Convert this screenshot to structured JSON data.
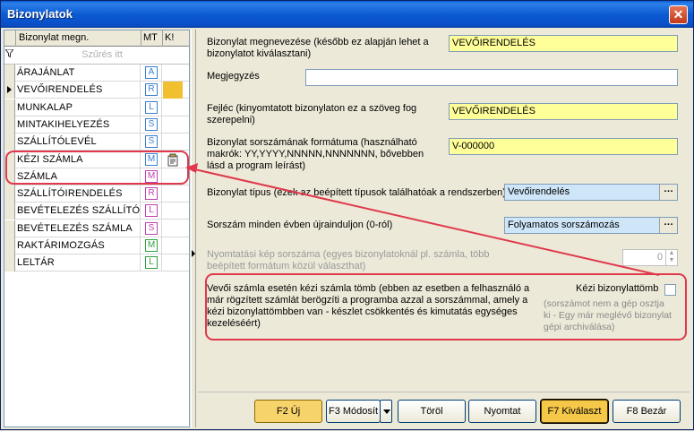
{
  "window": {
    "title": "Bizonylatok",
    "close_icon": "close-icon"
  },
  "grid": {
    "columns": [
      "Bizonylat megn.",
      "MT",
      "K!"
    ],
    "filter_placeholder": "Szűrés itt",
    "rows": [
      {
        "name": "ÁRAJÁNLAT",
        "mt": "A",
        "mt_color": "#3a7fd0",
        "selected": false,
        "k_icon": false
      },
      {
        "name": "VEVŐIRENDELÉS",
        "mt": "R",
        "mt_color": "#3a7fd0",
        "selected": true,
        "k_icon": false
      },
      {
        "name": "MUNKALAP",
        "mt": "L",
        "mt_color": "#3a7fd0",
        "selected": false,
        "k_icon": false
      },
      {
        "name": "MINTAKIHELYEZÉS",
        "mt": "S",
        "mt_color": "#3a7fd0",
        "selected": false,
        "k_icon": false
      },
      {
        "name": "SZÁLLÍTÓLEVÉL",
        "mt": "S",
        "mt_color": "#3a7fd0",
        "selected": false,
        "k_icon": false
      },
      {
        "name": "KÉZI SZÁMLA",
        "mt": "M",
        "mt_color": "#3a7fd0",
        "selected": false,
        "k_icon": true
      },
      {
        "name": "SZÁMLA",
        "mt": "M",
        "mt_color": "#c040b0",
        "selected": false,
        "k_icon": false
      },
      {
        "name": "SZÁLLÍTÓIRENDELÉS",
        "mt": "R",
        "mt_color": "#c040b0",
        "selected": false,
        "k_icon": false
      },
      {
        "name": "BEVÉTELEZÉS SZÁLLÍTÓ",
        "mt": "L",
        "mt_color": "#c040b0",
        "selected": false,
        "k_icon": false
      },
      {
        "name": "BEVÉTELEZÉS SZÁMLA",
        "mt": "S",
        "mt_color": "#c040b0",
        "selected": false,
        "k_icon": false
      },
      {
        "name": "RAKTÁRIMOZGÁS",
        "mt": "M",
        "mt_color": "#30a040",
        "selected": false,
        "k_icon": false
      },
      {
        "name": "LELTÁR",
        "mt": "L",
        "mt_color": "#30a040",
        "selected": false,
        "k_icon": false
      }
    ]
  },
  "form": {
    "name_label": "Bizonylat megnevezése (később ez alapján lehet a bizonylatot kiválasztani)",
    "name_value": "VEVŐIRENDELÉS",
    "comment_label": "Megjegyzés",
    "comment_value": "",
    "header_label": "Fejléc (kinyomtatott bizonylaton ez a szöveg fog szerepelni)",
    "header_value": "VEVŐIRENDELÉS",
    "format_label": "Bizonylat sorszámának formátuma (használható makrók: YY,YYYY,NNNNN,NNNNNNN, bővebben lásd a program leírást)",
    "format_value": "V-000000",
    "type_label": "Bizonylat típus (ezek az beépített típusok találhatóak a rendszerben)",
    "type_value": "Vevőirendelés",
    "reset_label": "Sorszám minden évben újrainduljon (0-ról)",
    "reset_value": "Folyamatos sorszámozás",
    "print_label": "Nyomtatási kép sorszáma (egyes bizonylatoknál pl. számla, több beépített formátum közül választhat)",
    "print_value": "0",
    "manual_desc": "Vevői számla esetén kézi számla tömb (ebben az esetben a felhasználó a már rögzített számlát berögzíti a programba azzal a sorszámmal, amely a kézi bizonylattömbben van - készlet csökkentés és kimutatás egységes kezeléséért)",
    "manual_checkbox_label": "Kézi bizonylattömb",
    "manual_checked": false,
    "manual_note": "(sorszámot nem a gép osztja ki - Egy már meglévő bizonylat gépi archiválása)"
  },
  "buttons": {
    "new": "F2 Új",
    "modify": "F3 Módosít",
    "delete": "Töröl",
    "print": "Nyomtat",
    "select": "F7 Kiválaszt",
    "close": "F8 Bezár"
  },
  "highlight_color": "#e0384c"
}
